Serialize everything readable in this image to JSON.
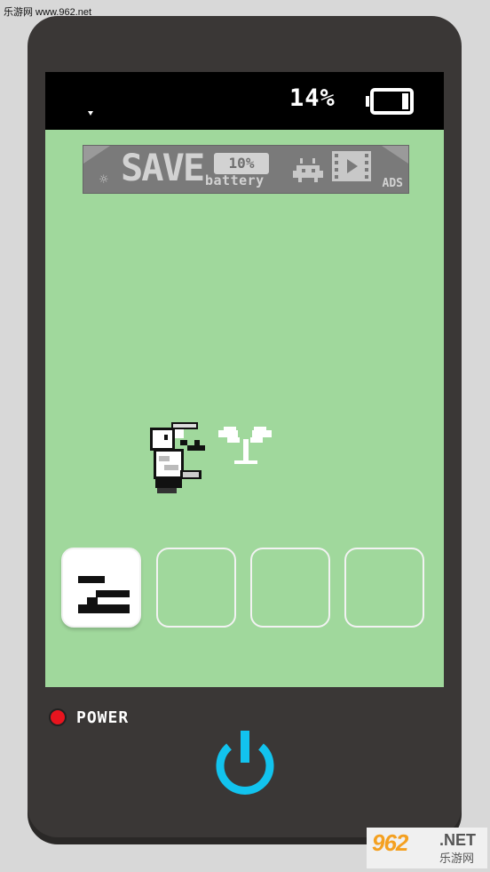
{
  "watermark": {
    "top_text": "乐游网 www.962.net",
    "brand": "962",
    "net": ".NET",
    "sub": "乐游网"
  },
  "status": {
    "battery_percent": "14%",
    "battery_level": 0.14
  },
  "banner": {
    "headline": "SAVE",
    "percent": "10%",
    "word": "battery",
    "ads_label": "ADS"
  },
  "slots": [
    {
      "state": "selected",
      "icon": "pixel-glyph-icon"
    },
    {
      "state": "empty"
    },
    {
      "state": "empty"
    },
    {
      "state": "empty"
    }
  ],
  "controls": {
    "power_label": "POWER"
  },
  "colors": {
    "screen": "#a0d89c",
    "device": "#3a3736",
    "led": "#e8141e",
    "power_button": "#12c3ee"
  }
}
